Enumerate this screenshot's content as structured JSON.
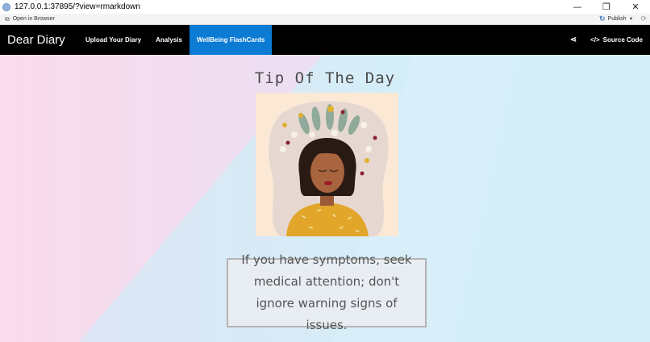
{
  "window": {
    "url": "127.0.0.1:37895/?view=rmarkdown",
    "controls": [
      "—",
      "❐",
      "✕"
    ]
  },
  "toolbar": {
    "open_in_browser": "Open in Browser",
    "publish": "Publish"
  },
  "navbar": {
    "brand": "Dear Diary",
    "items": [
      {
        "label": "Upload Your Diary",
        "active": false
      },
      {
        "label": "Analysis",
        "active": false
      },
      {
        "label": "WellBeing FlashCards",
        "active": true
      }
    ],
    "source_code": "Source Code"
  },
  "main": {
    "title": "Tip Of The Day",
    "tip": "If you have symptoms, seek medical attention; don't ignore warning signs of issues."
  },
  "colors": {
    "navbar_bg": "#000000",
    "active_tab": "#0b7bd4",
    "pink": "#f9dbeb",
    "blue": "#d6eef8"
  }
}
